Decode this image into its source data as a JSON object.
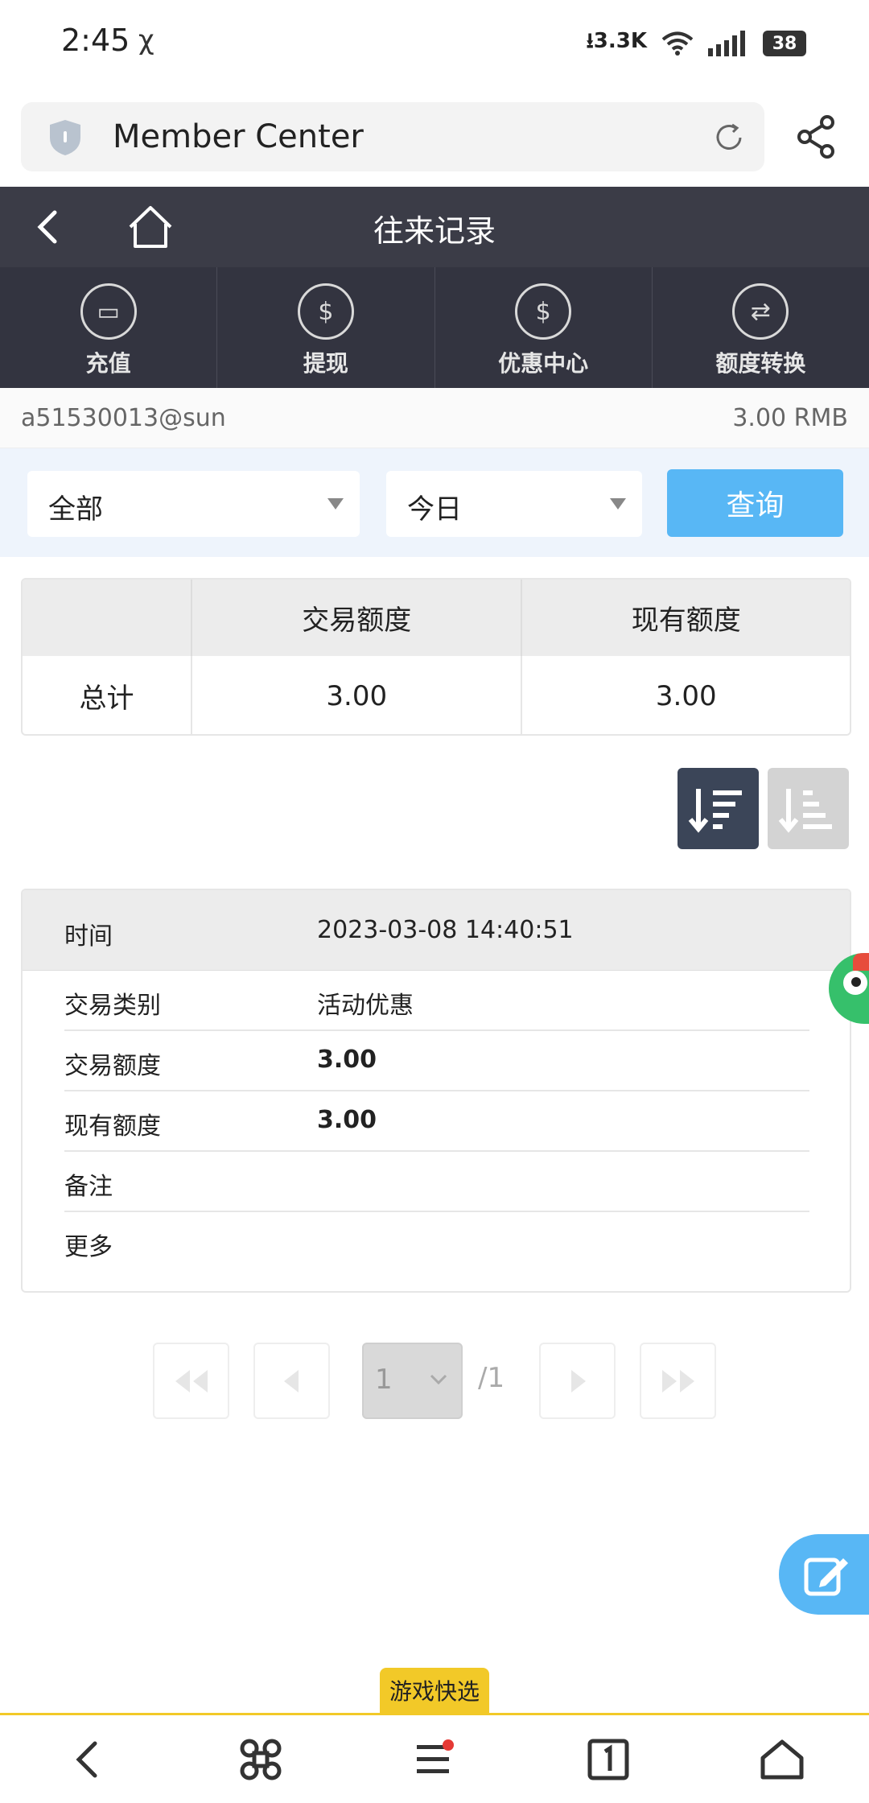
{
  "status_bar": {
    "time": "2:45",
    "carrier_icon": "χ",
    "download_speed": "3.3K",
    "battery": "38"
  },
  "browser": {
    "title": "Member Center"
  },
  "header": {
    "title": "往来记录"
  },
  "actions": [
    {
      "label": "充值",
      "icon": "card-hand-icon"
    },
    {
      "label": "提现",
      "icon": "dollar-hand-icon"
    },
    {
      "label": "优惠中心",
      "icon": "dollar-refresh-icon"
    },
    {
      "label": "额度转换",
      "icon": "exchange-icon"
    }
  ],
  "account": {
    "username": "a51530013@sun",
    "balance": "3.00 RMB"
  },
  "filter": {
    "type_selected": "全部",
    "date_selected": "今日",
    "query_label": "查询"
  },
  "summary": {
    "headers": [
      "",
      "交易额度",
      "现有额度"
    ],
    "row": {
      "label": "总计",
      "transaction": "3.00",
      "available": "3.00"
    }
  },
  "record": {
    "time_label": "时间",
    "time_value": "2023-03-08 14:40:51",
    "rows": [
      {
        "label": "交易类别",
        "value": "活动优惠",
        "bold": false
      },
      {
        "label": "交易额度",
        "value": "3.00",
        "bold": true
      },
      {
        "label": "现有额度",
        "value": "3.00",
        "bold": true
      },
      {
        "label": "备注",
        "value": "",
        "bold": false
      },
      {
        "label": "更多",
        "value": "",
        "bold": false
      }
    ]
  },
  "pagination": {
    "current_page": "1",
    "total": "/1"
  },
  "floating": {
    "game_tag": "游戏快选"
  },
  "colors": {
    "header_bg": "#3b3c47",
    "accent_blue": "#58b7f5",
    "tag_yellow": "#f2c928"
  }
}
